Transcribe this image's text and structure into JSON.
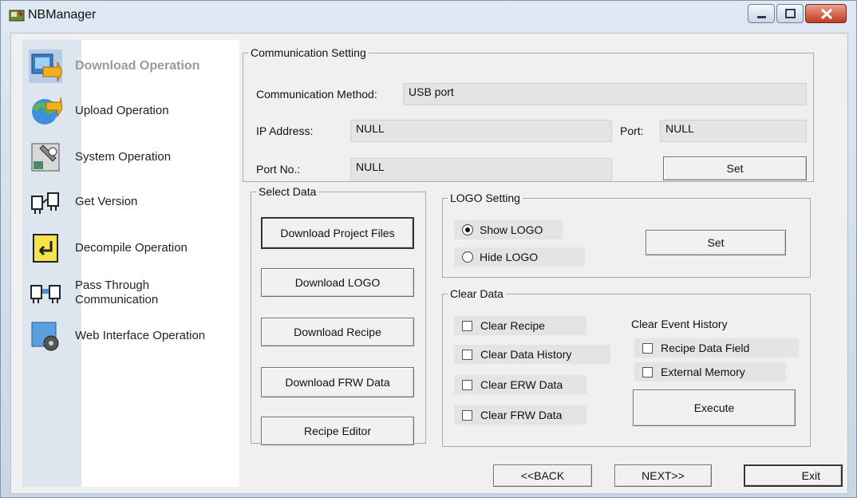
{
  "window": {
    "title": "NBManager",
    "icon": "app-icon"
  },
  "sidebar": {
    "items": [
      {
        "label": "Download Operation",
        "icon": "download-icon",
        "selected": true
      },
      {
        "label": "Upload Operation",
        "icon": "upload-icon"
      },
      {
        "label": "System Operation",
        "icon": "system-icon"
      },
      {
        "label": "Get Version",
        "icon": "version-icon"
      },
      {
        "label": "Decompile Operation",
        "icon": "decompile-icon"
      },
      {
        "label": "Pass Through\nCommunication",
        "icon": "pass-through-icon"
      },
      {
        "label": "Web Interface Operation",
        "icon": "web-interface-icon"
      }
    ]
  },
  "communication": {
    "legend": "Communication Setting",
    "method_label": "Communication Method:",
    "method_value": "USB port",
    "ip_label": "IP Address:",
    "ip_value": "NULL",
    "port_label": "Port:",
    "port_value": "NULL",
    "portno_label": "Port No.:",
    "portno_value": "NULL",
    "set_label": "Set"
  },
  "select_data": {
    "legend": "Select Data",
    "buttons": [
      "Download Project Files",
      "Download LOGO",
      "Download Recipe",
      "Download FRW Data",
      "Recipe Editor"
    ]
  },
  "logo": {
    "legend": "LOGO Setting",
    "show_label": "Show LOGO",
    "hide_label": "Hide LOGO",
    "selected": "Show LOGO",
    "set_label": "Set"
  },
  "clear_data": {
    "legend": "Clear Data",
    "items": [
      "Clear Recipe",
      "Clear Data History",
      "Clear ERW Data",
      "Clear FRW Data"
    ],
    "event_history_label": "Clear Event History",
    "event_items": [
      "Recipe Data Field",
      "External Memory"
    ],
    "execute_label": "Execute"
  },
  "footer": {
    "back_label": "<<BACK",
    "next_label": "NEXT>>",
    "exit_label": "Exit"
  }
}
